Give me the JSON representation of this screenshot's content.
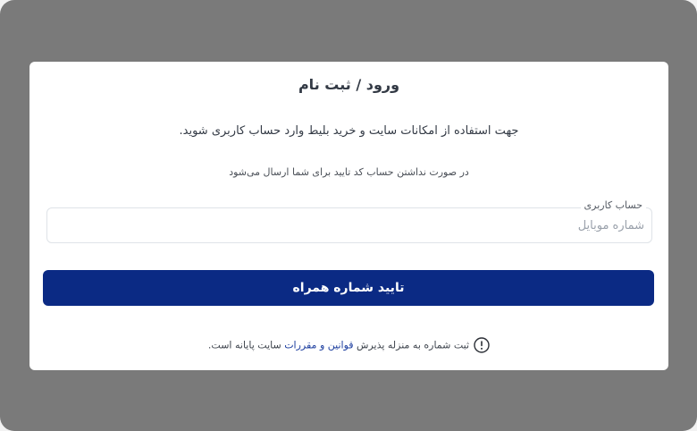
{
  "modal": {
    "title": "ورود / ثبت نام",
    "description": "جهت استفاده از امکانات سایت و خرید بلیط وارد حساب کاربری شوید.",
    "sub_description": "در صورت نداشتن حساب کد تایید برای شما ارسال می‌شود",
    "field": {
      "label": "حساب کاربری",
      "placeholder": "شماره موبایل",
      "value": ""
    },
    "submit_label": "تایید شماره همراه",
    "terms": {
      "icon": "exclamation-circle-icon",
      "before": "ثبت شماره به منزله پذیرش ",
      "link": "قوانین و مقررات",
      "after": " سایت پایانه است."
    }
  },
  "colors": {
    "backdrop": "#7a7a7a",
    "primary": "#0b2a84",
    "link": "#1a3c9e"
  }
}
